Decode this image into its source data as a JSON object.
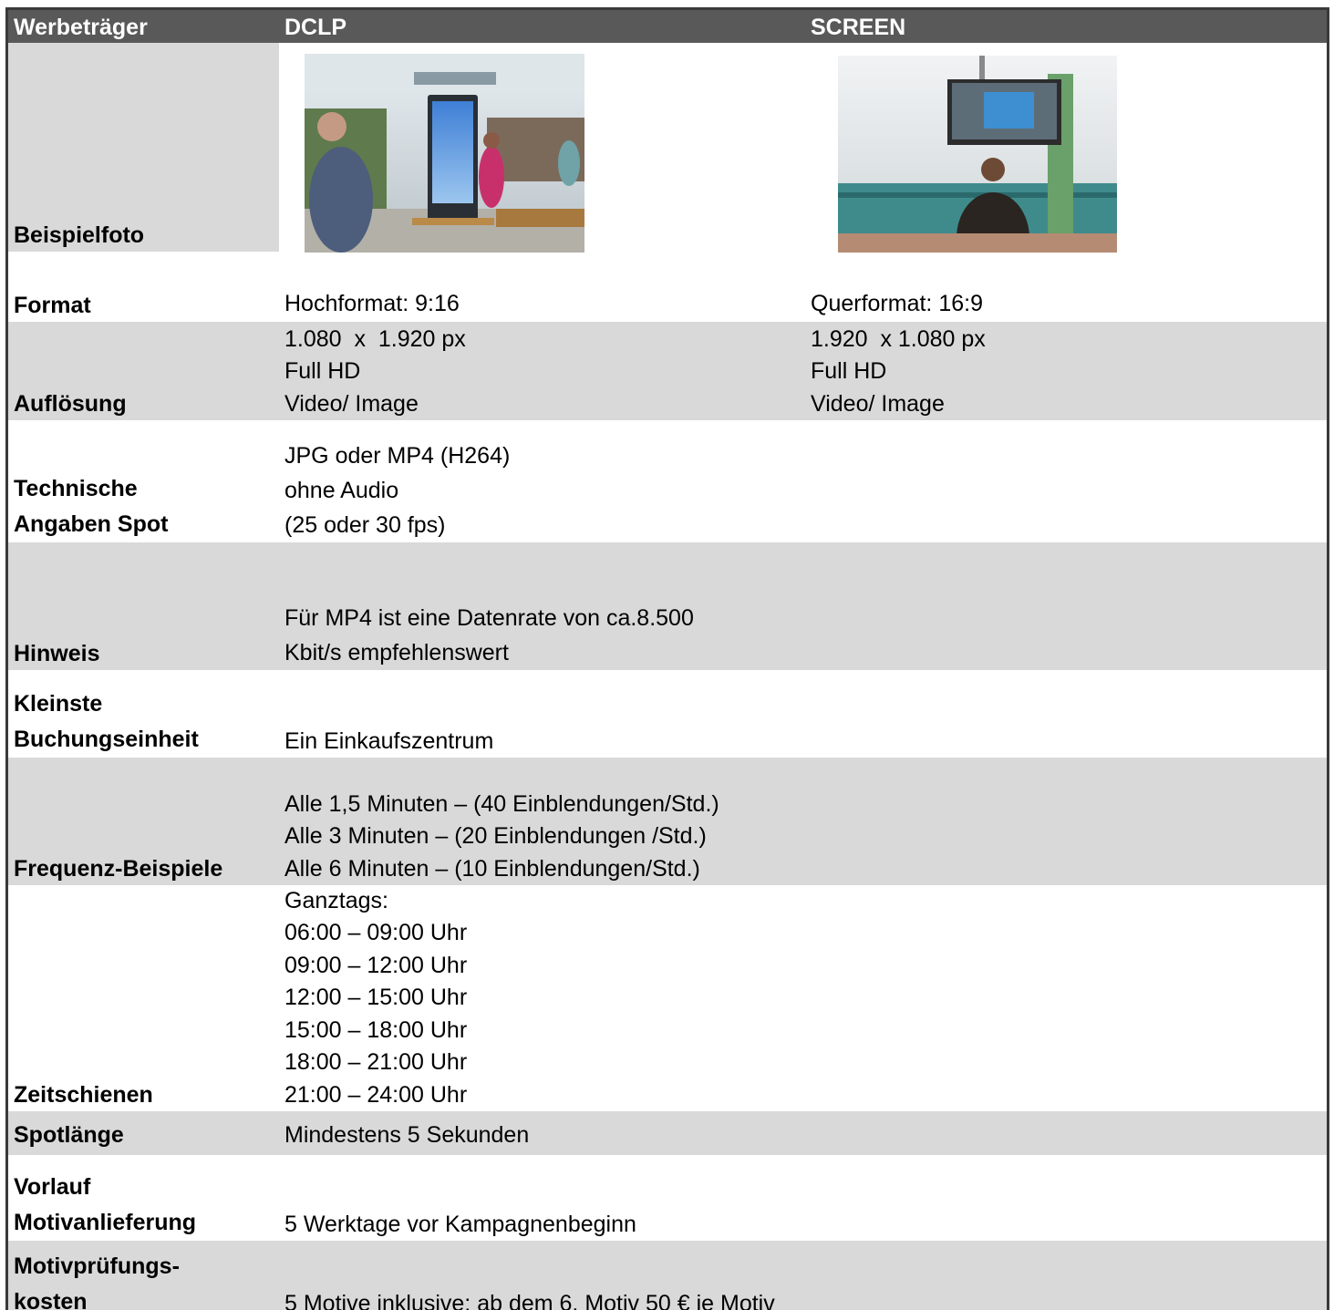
{
  "header": {
    "col1": "Werbeträger",
    "col2": "DCLP",
    "col3": "SCREEN"
  },
  "photo_row": {
    "label": "Beispielfoto",
    "dclp_photo": "mall-digital-stele-photo",
    "screen_photo": "mall-ceiling-screen-photo"
  },
  "format": {
    "label": "Format",
    "dclp": "Hochformat: 9:16",
    "screen": "Querformat: 16:9"
  },
  "aufloesung": {
    "label": "Auflösung",
    "dclp": "1.080  x  1.920 px\nFull HD\nVideo/ Image",
    "screen": "1.920  x 1.080 px\nFull HD\nVideo/ Image"
  },
  "technik": {
    "label": "Technische\nAngaben Spot",
    "value": "JPG oder MP4 (H264)\nohne Audio\n(25 oder 30 fps)"
  },
  "hinweis": {
    "label": "Hinweis",
    "value": "Für MP4 ist eine Datenrate von ca.8.500\nKbit/s empfehlenswert"
  },
  "buchung": {
    "label": "Kleinste\nBuchungseinheit",
    "value": "Ein Einkaufszentrum"
  },
  "frequenz": {
    "label": "Frequenz-Beispiele",
    "value": "Alle 1,5 Minuten – (40 Einblendungen/Std.)\nAlle 3 Minuten – (20 Einblendungen /Std.)\nAlle 6 Minuten – (10 Einblendungen/Std.)"
  },
  "zeitschienen": {
    "label": "Zeitschienen",
    "value": "Ganztags:\n06:00 – 09:00 Uhr\n09:00 – 12:00 Uhr\n12:00 – 15:00 Uhr\n15:00 – 18:00 Uhr\n18:00 – 21:00 Uhr\n21:00 – 24:00 Uhr"
  },
  "spotlaenge": {
    "label": "Spotlänge",
    "value": "Mindestens 5 Sekunden"
  },
  "vorlauf": {
    "label": "Vorlauf\nMotivanlieferung",
    "value": "5 Werktage vor Kampagnenbeginn"
  },
  "kosten": {
    "label": "Motivprüfungs-\nkosten",
    "value": "5 Motive inklusive; ab dem 6. Motiv 50 € je Motiv"
  },
  "colors": {
    "header_bg": "#595959",
    "row_gray": "#d9d9d9",
    "border": "#3a3a3a"
  }
}
